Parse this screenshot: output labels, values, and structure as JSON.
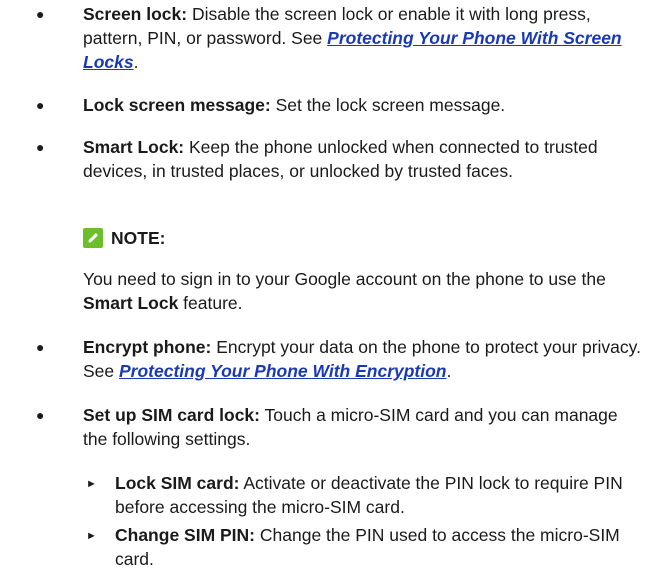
{
  "items": [
    {
      "label": "Screen lock:",
      "text": " Disable the screen lock or enable it with long press, pattern, PIN, or password. See ",
      "link": "Protecting Your Phone With Screen Locks",
      "after": "."
    },
    {
      "label": "Lock screen message:",
      "text": " Set the lock screen message."
    },
    {
      "label": "Smart Lock:",
      "text": " Keep the phone unlocked when connected to trusted devices, in trusted places, or unlocked by trusted faces."
    },
    {
      "label": "Encrypt phone:",
      "text": " Encrypt your data on the phone to protect your privacy. See ",
      "link": "Protecting Your Phone With Encryption",
      "after": "."
    },
    {
      "label": "Set up SIM card lock:",
      "text": " Touch a micro-SIM card and you can manage the following settings."
    }
  ],
  "note": {
    "heading": "NOTE:",
    "text_before": "You need to sign in to your Google account on the phone to use the ",
    "bold": "Smart Lock",
    "text_after": " feature.",
    "icon": "pencil-icon",
    "icon_color": "#6cbf2a"
  },
  "sub_items": [
    {
      "label": "Lock SIM card:",
      "text": " Activate or deactivate the PIN lock to require PIN before accessing the micro-SIM card."
    },
    {
      "label": "Change SIM PIN:",
      "text": " Change the PIN used to access the micro-SIM card."
    }
  ],
  "colors": {
    "link": "#1a39b5",
    "text": "#1a1a1a"
  }
}
